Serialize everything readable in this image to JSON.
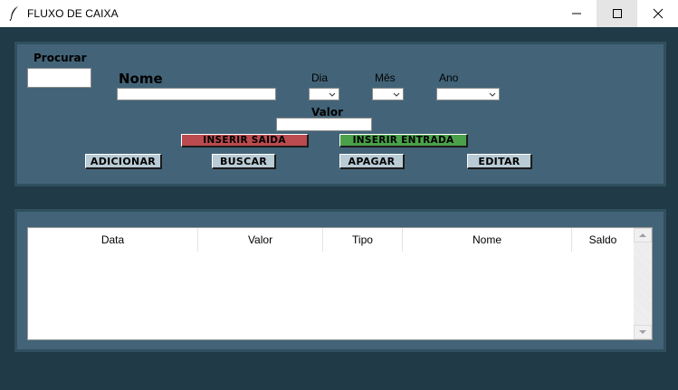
{
  "window": {
    "title": "FLUXO DE CAIXA",
    "icons": {
      "app": "feather-icon",
      "minimize": "minimize-icon",
      "maximize": "maximize-icon",
      "close": "close-icon"
    }
  },
  "form": {
    "search_label": "Procurar",
    "name_label": "Nome",
    "day_label": "Dia",
    "month_label": "Mês",
    "year_label": "Ano",
    "value_label": "Valor",
    "search_value": "",
    "name_value": "",
    "value_value": ""
  },
  "buttons": {
    "insert_exit": "INSERIR SAIDA",
    "insert_entry": "INSERIR ENTRADA",
    "add": "ADICIONAR",
    "search": "BUSCAR",
    "delete": "APAGAR",
    "edit": "EDITAR"
  },
  "table": {
    "columns": [
      "Data",
      "Valor",
      "Tipo",
      "Nome",
      "Saldo"
    ],
    "rows": []
  },
  "colors": {
    "background": "#213a47",
    "panel": "#436478",
    "button": "#b9cbd5",
    "button_exit": "#bb4b4f",
    "button_entry": "#4aa14a"
  }
}
